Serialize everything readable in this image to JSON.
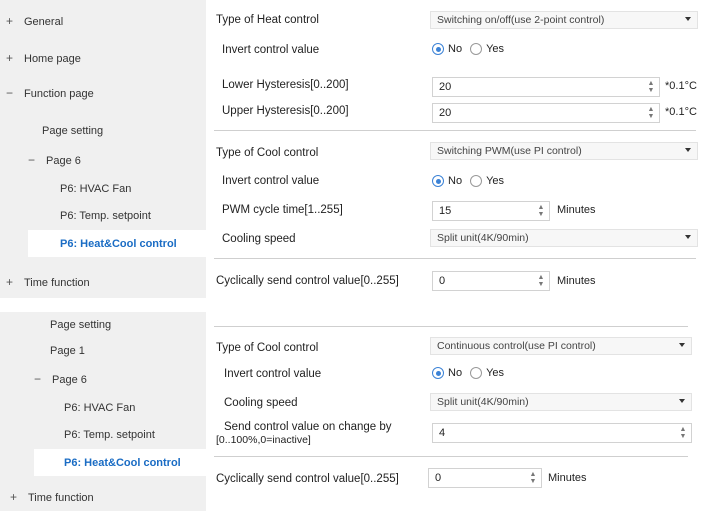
{
  "panel1": {
    "nav": {
      "general": "General",
      "home_page": "Home page",
      "function_page": "Function page",
      "page_setting": "Page setting",
      "page6": "Page 6",
      "hvac_fan": "P6: HVAC Fan",
      "temp_setpoint": "P6: Temp. setpoint",
      "heat_cool": "P6: Heat&Cool control",
      "time_function": "Time function"
    },
    "heat": {
      "type_label": "Type of Heat control",
      "type_value": "Switching on/off(use 2-point control)",
      "invert_label": "Invert control value",
      "no": "No",
      "yes": "Yes",
      "lower_label": "Lower Hysteresis[0..200]",
      "lower_value": "20",
      "upper_label": "Upper Hysteresis[0..200]",
      "upper_value": "20",
      "unit": "*0.1°C"
    },
    "cool": {
      "type_label": "Type of Cool control",
      "type_value": "Switching PWM(use PI control)",
      "invert_label": "Invert control value",
      "no": "No",
      "yes": "Yes",
      "pwm_label": "PWM cycle time[1..255]",
      "pwm_value": "15",
      "pwm_unit": "Minutes",
      "speed_label": "Cooling speed",
      "speed_value": "Split unit(4K/90min)"
    },
    "cyclic": {
      "label": "Cyclically send control value[0..255]",
      "value": "0",
      "unit": "Minutes"
    }
  },
  "panel2": {
    "nav": {
      "page_setting": "Page setting",
      "page1": "Page 1",
      "page6": "Page 6",
      "hvac_fan": "P6: HVAC Fan",
      "temp_setpoint": "P6: Temp. setpoint",
      "heat_cool": "P6: Heat&Cool control",
      "time_function": "Time function"
    },
    "cool": {
      "type_label": "Type of Cool control",
      "type_value": "Continuous control(use PI control)",
      "invert_label": "Invert control value",
      "no": "No",
      "yes": "Yes",
      "speed_label": "Cooling speed",
      "speed_value": "Split unit(4K/90min)",
      "change_label_1": "Send control value on change by",
      "change_label_2": "[0..100%,0=inactive]",
      "change_value": "4"
    },
    "cyclic": {
      "label": "Cyclically send control value[0..255]",
      "value": "0",
      "unit": "Minutes"
    }
  }
}
